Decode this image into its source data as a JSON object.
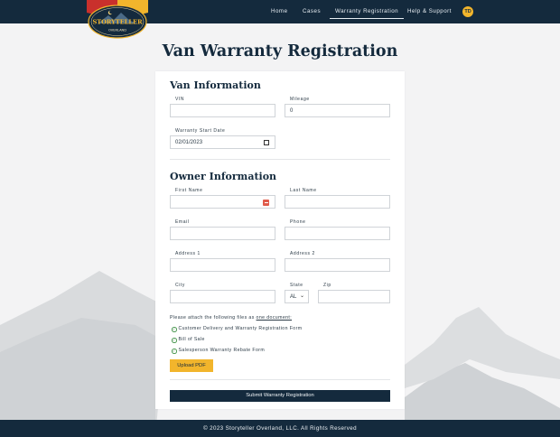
{
  "nav": {
    "logo_text_top": "STORYTELLER",
    "logo_text_bottom": "OVERLAND",
    "links": [
      "Home",
      "Cases",
      "Warranty Registration",
      "Help & Support"
    ],
    "active_link": "Warranty Registration",
    "avatar_initials": "TD"
  },
  "page": {
    "title": "Van Warranty Registration"
  },
  "van_info": {
    "heading": "Van Information",
    "vin_label": "VIN",
    "vin_value": "",
    "mileage_label": "Mileage",
    "mileage_value": "0",
    "start_date_label": "Warranty Start Date",
    "start_date_value": "02/01/2023"
  },
  "owner_info": {
    "heading": "Owner Information",
    "first_name_label": "First Name",
    "first_name_value": "",
    "last_name_label": "Last Name",
    "last_name_value": "",
    "email_label": "Email",
    "email_value": "",
    "phone_label": "Phone",
    "phone_value": "",
    "address1_label": "Address 1",
    "address1_value": "",
    "address2_label": "Address 2",
    "address2_value": "",
    "city_label": "City",
    "city_value": "",
    "state_label": "State",
    "state_value": "AL",
    "zip_label": "Zip",
    "zip_value": ""
  },
  "attachments": {
    "instruction_prefix": "Please attach the following files as ",
    "instruction_link": "one document:",
    "documents": [
      "Customer Delivery and Warranty Registration Form",
      "Bill of Sale",
      "Salesperson Warranty Rebate Form"
    ],
    "upload_label": "Upload PDF"
  },
  "submit_label": "Submit Warranty Registration",
  "footer": {
    "text": "© 2023 Storyteller Overland, LLC. All Rights Reserved"
  },
  "colors": {
    "navy": "#142a3d",
    "accent_yellow": "#f2b52c",
    "logo_red": "#c9302c",
    "check_green": "#4f9a55"
  }
}
